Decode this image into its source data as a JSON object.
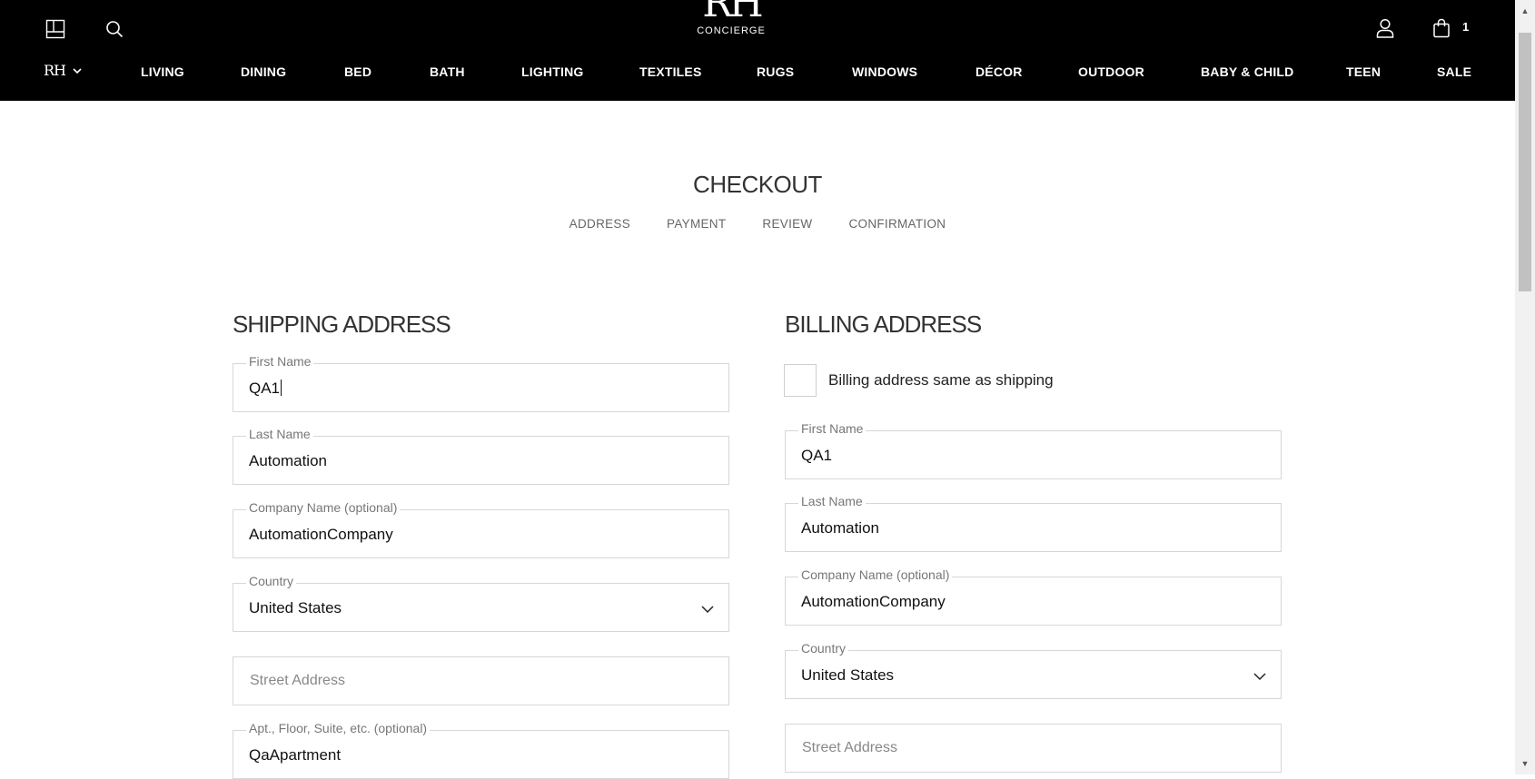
{
  "header": {
    "logo_mark": "RH",
    "logo_sub": "CONCIERGE",
    "cart_count": "1",
    "brand_select": "RH",
    "icons": {
      "layout": "layout-grid-icon",
      "search": "search-icon",
      "account": "user-icon",
      "cart": "shopping-bag-icon",
      "chevron": "chevron-down-icon"
    },
    "nav": [
      "LIVING",
      "DINING",
      "BED",
      "BATH",
      "LIGHTING",
      "TEXTILES",
      "RUGS",
      "WINDOWS",
      "DÉCOR",
      "OUTDOOR",
      "BABY & CHILD",
      "TEEN",
      "SALE"
    ]
  },
  "checkout": {
    "title": "CHECKOUT",
    "steps": [
      "ADDRESS",
      "PAYMENT",
      "REVIEW",
      "CONFIRMATION"
    ]
  },
  "shipping": {
    "title": "SHIPPING ADDRESS",
    "first_name": {
      "label": "First Name",
      "value": "QA1"
    },
    "last_name": {
      "label": "Last Name",
      "value": "Automation"
    },
    "company": {
      "label": "Company Name (optional)",
      "value": "AutomationCompany"
    },
    "country": {
      "label": "Country",
      "value": "United States"
    },
    "street": {
      "placeholder": "Street Address"
    },
    "apt": {
      "label": "Apt., Floor, Suite, etc. (optional)",
      "value": "QaApartment"
    }
  },
  "billing": {
    "title": "BILLING ADDRESS",
    "same_as_shipping": "Billing address same as shipping",
    "first_name": {
      "label": "First Name",
      "value": "QA1"
    },
    "last_name": {
      "label": "Last Name",
      "value": "Automation"
    },
    "company": {
      "label": "Company Name (optional)",
      "value": "AutomationCompany"
    },
    "country": {
      "label": "Country",
      "value": "United States"
    },
    "street": {
      "placeholder": "Street Address"
    }
  },
  "colors": {
    "header_bg": "#000000",
    "border": "#d7d7d7",
    "label": "#777777"
  }
}
